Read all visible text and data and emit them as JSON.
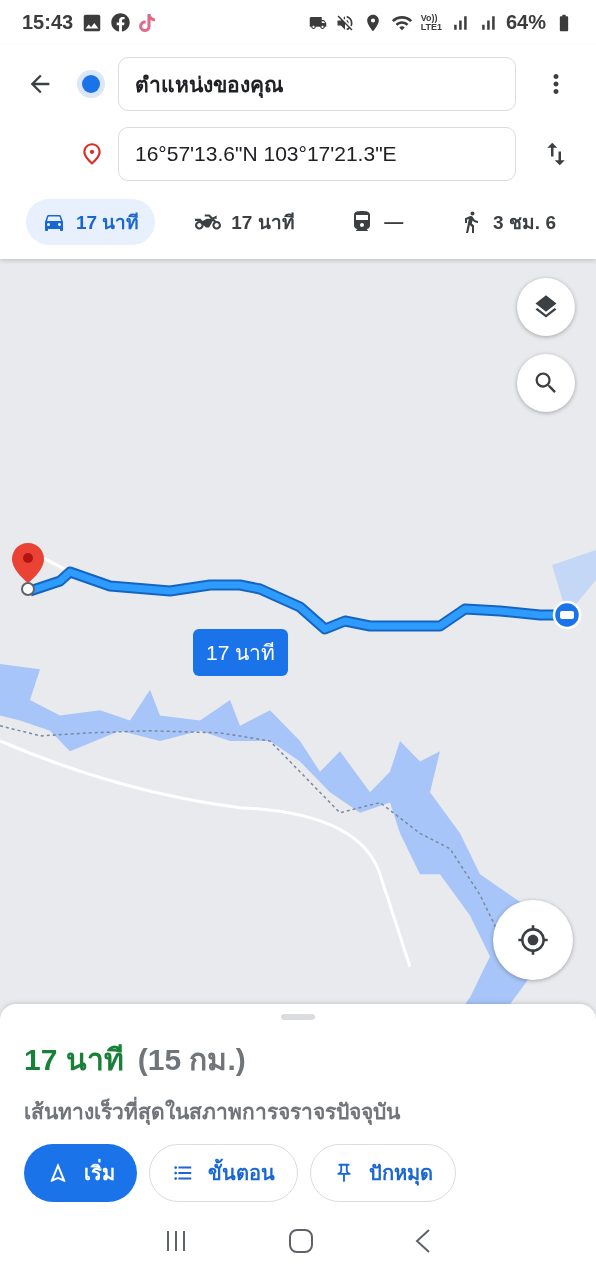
{
  "status_bar": {
    "time": "15:43",
    "network_label": [
      "Vo))",
      "LTE1"
    ],
    "battery": "64%"
  },
  "route": {
    "origin": {
      "value": "ตำแหน่งของคุณ"
    },
    "destination": {
      "value": "16°57'13.6\"N 103°17'21.3\"E"
    }
  },
  "modes": [
    {
      "kind": "car",
      "label": "17 นาที",
      "selected": true
    },
    {
      "kind": "motorbike",
      "label": "17 นาที",
      "selected": false
    },
    {
      "kind": "transit",
      "label": "—",
      "selected": false
    },
    {
      "kind": "walk",
      "label": "3 ชม. 6",
      "selected": false
    }
  ],
  "map": {
    "route_label": "17 นาที"
  },
  "sheet": {
    "duration": "17 นาที",
    "distance": "(15 กม.)",
    "description": "เส้นทางเร็วที่สุดในสภาพการจราจรปัจจุบัน",
    "actions": [
      {
        "kind": "start",
        "label": "เริ่ม"
      },
      {
        "kind": "steps",
        "label": "ขั้นตอน"
      },
      {
        "kind": "pin",
        "label": "ปักหมุด"
      }
    ]
  }
}
